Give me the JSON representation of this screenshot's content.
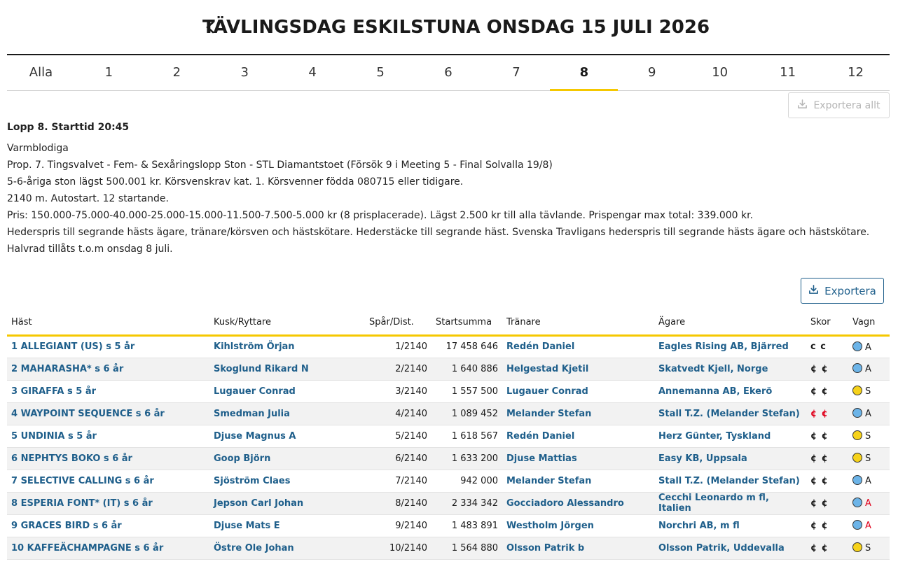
{
  "page": {
    "title": "TÄVLINGSDAG ESKILSTUNA ONSDAG 15 JULI 2026"
  },
  "tabs": [
    {
      "label": "Alla",
      "active": false
    },
    {
      "label": "1",
      "active": false
    },
    {
      "label": "2",
      "active": false
    },
    {
      "label": "3",
      "active": false
    },
    {
      "label": "4",
      "active": false
    },
    {
      "label": "5",
      "active": false
    },
    {
      "label": "6",
      "active": false
    },
    {
      "label": "7",
      "active": false
    },
    {
      "label": "8",
      "active": true
    },
    {
      "label": "9",
      "active": false
    },
    {
      "label": "10",
      "active": false
    },
    {
      "label": "11",
      "active": false
    },
    {
      "label": "12",
      "active": false
    }
  ],
  "actions": {
    "export_all": "Exportera allt",
    "export": "Exportera"
  },
  "race": {
    "heading": "Lopp 8. Starttid 20:45",
    "lines": [
      "Varmblodiga",
      "Prop. 7. Tingsvalvet - Fem- & Sexåringslopp Ston - STL Diamantstoet (Försök 9 i Meeting 5 - Final Solvalla 19/8)",
      "5-6-åriga ston lägst 500.001 kr. Körsvenskrav kat. 1. Körsvenner födda 080715 eller tidigare.",
      "2140 m. Autostart. 12 startande.",
      "Pris: 150.000-75.000-40.000-25.000-15.000-11.500-7.500-5.000 kr (8 prisplacerade). Lägst 2.500 kr till alla tävlande. Prispengar max total: 339.000 kr.",
      "Hederspris till segrande hästs ägare, tränare/körsven och hästskötare. Hederstäcke till segrande häst. Svenska Travligans hederspris till segrande hästs ägare och hästskötare.",
      "Halvrad tillåts t.o.m onsdag 8 juli."
    ]
  },
  "table": {
    "columns": [
      "Häst",
      "Kusk/Ryttare",
      "Spår/Dist.",
      "Startsumma",
      "Tränare",
      "Ägare",
      "Skor",
      "Vagn"
    ],
    "rows": [
      {
        "horse": "1 ALLEGIANT (US) s 5 år",
        "driver": "Kihlström Örjan",
        "post": "1/2140",
        "earnings": "17 458 646",
        "trainer": "Redén Daniel",
        "owner": "Eagles Rising AB, Bjärred",
        "shoes": "c c",
        "shoes_color": "#1a1a1a",
        "cart_color": "#6cb4e8",
        "cart": "A",
        "cart_text_color": "#1a1a1a"
      },
      {
        "horse": "2 MAHARASHA* s 6 år",
        "driver": "Skoglund Rikard N",
        "post": "2/2140",
        "earnings": "1 640 886",
        "trainer": "Helgestad Kjetil",
        "owner": "Skatvedt Kjell, Norge",
        "shoes": "¢ ¢",
        "shoes_color": "#1a1a1a",
        "cart_color": "#6cb4e8",
        "cart": "A",
        "cart_text_color": "#1a1a1a"
      },
      {
        "horse": "3 GIRAFFA s 5 år",
        "driver": "Lugauer Conrad",
        "post": "3/2140",
        "earnings": "1 557 500",
        "trainer": "Lugauer Conrad",
        "owner": "Annemanna AB, Ekerö",
        "shoes": "¢ ¢",
        "shoes_color": "#1a1a1a",
        "cart_color": "#f6d21a",
        "cart": "S",
        "cart_text_color": "#1a1a1a"
      },
      {
        "horse": "4 WAYPOINT SEQUENCE s 6 år",
        "driver": "Smedman Julia",
        "post": "4/2140",
        "earnings": "1 089 452",
        "trainer": "Melander Stefan",
        "owner": "Stall T.Z. (Melander Stefan)",
        "shoes": "¢ ¢",
        "shoes_color": "#e0001b",
        "cart_color": "#6cb4e8",
        "cart": "A",
        "cart_text_color": "#1a1a1a"
      },
      {
        "horse": "5 UNDINIA s 5 år",
        "driver": "Djuse Magnus A",
        "post": "5/2140",
        "earnings": "1 618 567",
        "trainer": "Redén Daniel",
        "owner": "Herz Günter, Tyskland",
        "shoes": "¢ ¢",
        "shoes_color": "#1a1a1a",
        "cart_color": "#f6d21a",
        "cart": "S",
        "cart_text_color": "#1a1a1a"
      },
      {
        "horse": "6 NEPHTYS BOKO s 6 år",
        "driver": "Goop Björn",
        "post": "6/2140",
        "earnings": "1 633 200",
        "trainer": "Djuse Mattias",
        "owner": "Easy KB, Uppsala",
        "shoes": "¢ ¢",
        "shoes_color": "#1a1a1a",
        "cart_color": "#f6d21a",
        "cart": "S",
        "cart_text_color": "#1a1a1a"
      },
      {
        "horse": "7 SELECTIVE CALLING s 6 år",
        "driver": "Sjöström Claes",
        "post": "7/2140",
        "earnings": "942 000",
        "trainer": "Melander Stefan",
        "owner": "Stall T.Z. (Melander Stefan)",
        "shoes": "¢ ¢",
        "shoes_color": "#1a1a1a",
        "cart_color": "#6cb4e8",
        "cart": "A",
        "cart_text_color": "#1a1a1a"
      },
      {
        "horse": "8 ESPERIA FONT* (IT) s 6 år",
        "driver": "Jepson Carl Johan",
        "post": "8/2140",
        "earnings": "2 334 342",
        "trainer": "Gocciadoro Alessandro",
        "owner": "Cecchi Leonardo m fl, Italien",
        "shoes": "¢ ¢",
        "shoes_color": "#1a1a1a",
        "cart_color": "#6cb4e8",
        "cart": "A",
        "cart_text_color": "#e0001b"
      },
      {
        "horse": "9 GRACES BIRD s 6 år",
        "driver": "Djuse Mats E",
        "post": "9/2140",
        "earnings": "1 483 891",
        "trainer": "Westholm Jörgen",
        "owner": "Norchri AB, m fl",
        "shoes": "¢ ¢",
        "shoes_color": "#1a1a1a",
        "cart_color": "#6cb4e8",
        "cart": "A",
        "cart_text_color": "#e0001b"
      },
      {
        "horse": "10 KAFFEÄCHAMPAGNE s 6 år",
        "driver": "Östre Ole Johan",
        "post": "10/2140",
        "earnings": "1 564 880",
        "trainer": "Olsson Patrik b",
        "owner": "Olsson Patrik, Uddevalla",
        "shoes": "¢ ¢",
        "shoes_color": "#1a1a1a",
        "cart_color": "#f6d21a",
        "cart": "S",
        "cart_text_color": "#1a1a1a"
      }
    ]
  }
}
